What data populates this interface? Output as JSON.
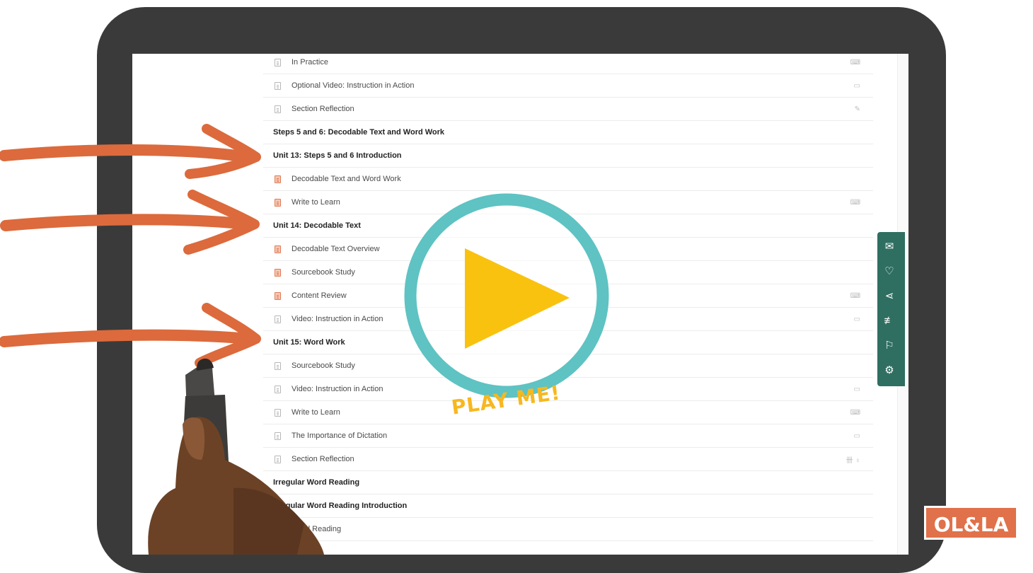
{
  "course_list": [
    {
      "type": "item",
      "label": "In Practice",
      "icon": "orange-no",
      "right": "⌨"
    },
    {
      "type": "item",
      "label": "Optional Video: Instruction in Action",
      "icon": "orange-no",
      "right": "▭"
    },
    {
      "type": "item",
      "label": "Section Reflection",
      "icon": "orange-no",
      "right": "✎"
    },
    {
      "type": "section",
      "label": "Steps 5 and 6: Decodable Text and Word Work"
    },
    {
      "type": "section",
      "label": "Unit 13: Steps 5 and 6 Introduction"
    },
    {
      "type": "item",
      "label": "Decodable Text and Word Work",
      "icon": "orange",
      "right": ""
    },
    {
      "type": "item",
      "label": "Write to Learn",
      "icon": "orange",
      "right": "⌨"
    },
    {
      "type": "section",
      "label": "Unit 14: Decodable Text"
    },
    {
      "type": "item",
      "label": "Decodable Text Overview",
      "icon": "orange",
      "right": ""
    },
    {
      "type": "item",
      "label": "Sourcebook Study",
      "icon": "orange",
      "right": ""
    },
    {
      "type": "item",
      "label": "Content Review",
      "icon": "orange",
      "right": "⌨"
    },
    {
      "type": "item",
      "label": "Video: Instruction in Action",
      "icon": "orange-no",
      "right": "▭"
    },
    {
      "type": "section",
      "label": "Unit 15: Word Work"
    },
    {
      "type": "item",
      "label": "Sourcebook Study",
      "icon": "orange-no",
      "right": ""
    },
    {
      "type": "item",
      "label": "Video: Instruction in Action",
      "icon": "orange-no",
      "right": "▭"
    },
    {
      "type": "item",
      "label": "Write to Learn",
      "icon": "orange-no",
      "right": "⌨"
    },
    {
      "type": "item",
      "label": "The Importance of Dictation",
      "icon": "orange-no",
      "right": "▭"
    },
    {
      "type": "item",
      "label": "Section Reflection",
      "icon": "orange-no",
      "right": "卌 ♀"
    },
    {
      "type": "section",
      "label": "Irregular Word Reading"
    },
    {
      "type": "section",
      "label": "Irregular Word Reading Introduction"
    },
    {
      "type": "item",
      "label": "Word Reading",
      "icon": "orange-no",
      "right": ""
    }
  ],
  "sidebar_icons": [
    {
      "name": "mail-icon",
      "glyph": "✉"
    },
    {
      "name": "heart-icon",
      "glyph": "♡"
    },
    {
      "name": "share-icon",
      "glyph": "⋖"
    },
    {
      "name": "add-to-list-icon",
      "glyph": "≢"
    },
    {
      "name": "flag-icon",
      "glyph": "⚐"
    },
    {
      "name": "settings-icon",
      "glyph": "⚙"
    }
  ],
  "play_label": "PLAY ME!",
  "brand": "OL&LA",
  "colors": {
    "accent_orange": "#e0714a",
    "teal": "#5ec3c2",
    "play_yellow": "#f9c20f",
    "sidebar": "#2f6f62"
  }
}
